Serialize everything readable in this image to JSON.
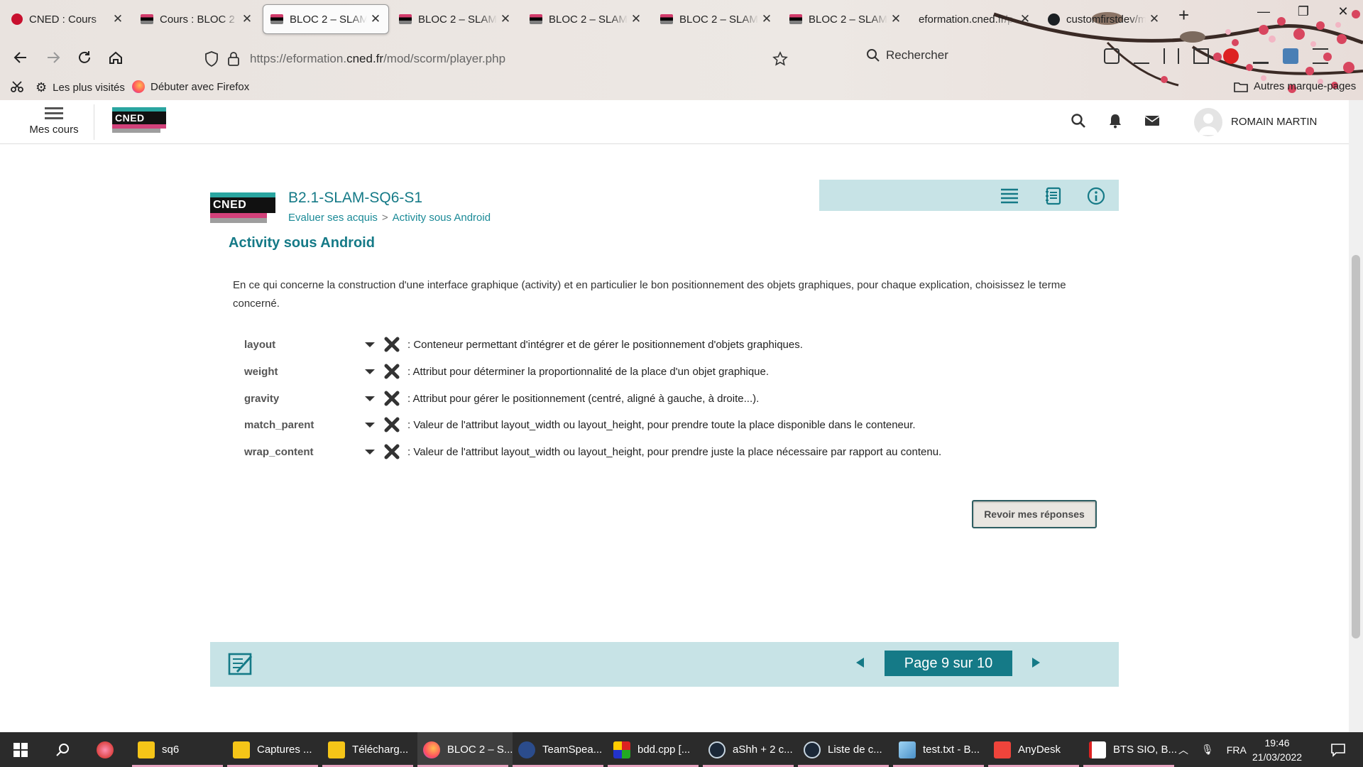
{
  "browser": {
    "tabs": [
      {
        "title": "CNED : Cours",
        "favicon": "360-icon",
        "active": false
      },
      {
        "title": "Cours : BLOC 2 –",
        "favicon": "cned-icon",
        "active": false
      },
      {
        "title": "BLOC 2 – SLAM –",
        "favicon": "cned-icon",
        "active": true
      },
      {
        "title": "BLOC 2 – SLAM –",
        "favicon": "cned-icon",
        "active": false
      },
      {
        "title": "BLOC 2 – SLAM –",
        "favicon": "cned-icon",
        "active": false
      },
      {
        "title": "BLOC 2 – SLAM –",
        "favicon": "cned-icon",
        "active": false
      },
      {
        "title": "BLOC 2 – SLAM –",
        "favicon": "cned-icon",
        "active": false
      },
      {
        "title": "eformation.cned.fr/p",
        "favicon": "",
        "active": false
      },
      {
        "title": "customfirstdev/m",
        "favicon": "github-icon",
        "active": false
      }
    ],
    "url_prefix": "https://eformation.",
    "url_domain": "cned.fr",
    "url_path": "/mod/scorm/player.php",
    "search_placeholder": "Rechercher",
    "bookmarks": {
      "most_visited": "Les plus visités",
      "getting_started": "Débuter avec Firefox",
      "other": "Autres marque-pages"
    }
  },
  "site": {
    "menu_label": "Mes cours",
    "logo_text": "CNED",
    "user_name": "ROMAIN MARTIN"
  },
  "module": {
    "code": "B2.1-SLAM-SQ6-S1",
    "breadcrumb": [
      "Evaluer ses acquis",
      "Activity sous Android"
    ],
    "breadcrumb_sep": ">",
    "title": "Activity sous Android",
    "intro": "En ce qui concerne la construction d'une interface graphique (activity) et en particulier le bon positionnement des objets graphiques, pour chaque explication, choisissez le terme concerné.",
    "questions": [
      {
        "selected": "layout",
        "definition": ": Conteneur permettant d'intégrer et de gérer le positionnement d'objets graphiques.",
        "status": "wrong"
      },
      {
        "selected": "weight",
        "definition": ": Attribut pour déterminer la proportionnalité de la place d'un objet graphique.",
        "status": "wrong"
      },
      {
        "selected": "gravity",
        "definition": ": Attribut pour gérer le positionnement (centré, aligné à gauche, à droite...).",
        "status": "wrong"
      },
      {
        "selected": "match_parent",
        "definition": ": Valeur de l'attribut layout_width ou layout_height, pour prendre toute la place disponible dans le conteneur.",
        "status": "wrong"
      },
      {
        "selected": "wrap_content",
        "definition": ": Valeur de l'attribut layout_width ou layout_height, pour prendre juste la place nécessaire par rapport au contenu.",
        "status": "wrong"
      }
    ],
    "review_button": "Revoir mes réponses",
    "pager_label": "Page 9 sur 10",
    "current_page": 9,
    "total_pages": 10
  },
  "taskbar": {
    "apps": [
      {
        "label": "sq6",
        "icon": "folder-icon"
      },
      {
        "label": "Captures ...",
        "icon": "folder-icon"
      },
      {
        "label": "Télécharg...",
        "icon": "folder-icon"
      },
      {
        "label": "BLOC 2 – S...",
        "icon": "firefox-icon",
        "active": true
      },
      {
        "label": "TeamSpea...",
        "icon": "teamspeak-icon"
      },
      {
        "label": "bdd.cpp [...",
        "icon": "codeblocks-icon"
      },
      {
        "label": "aShh + 2 c...",
        "icon": "steam-icon"
      },
      {
        "label": "Liste de c...",
        "icon": "steam-icon"
      },
      {
        "label": "test.txt - B...",
        "icon": "notepad-icon"
      },
      {
        "label": "AnyDesk",
        "icon": "anydesk-icon"
      },
      {
        "label": "BTS SIO, B...",
        "icon": "pdf-icon"
      }
    ],
    "language": "FRA",
    "time": "19:46",
    "date": "21/03/2022"
  },
  "colors": {
    "accent": "#157a87",
    "panel": "#c7e3e6",
    "wrong": "#333333",
    "taskbar": "#2b2b2b"
  }
}
